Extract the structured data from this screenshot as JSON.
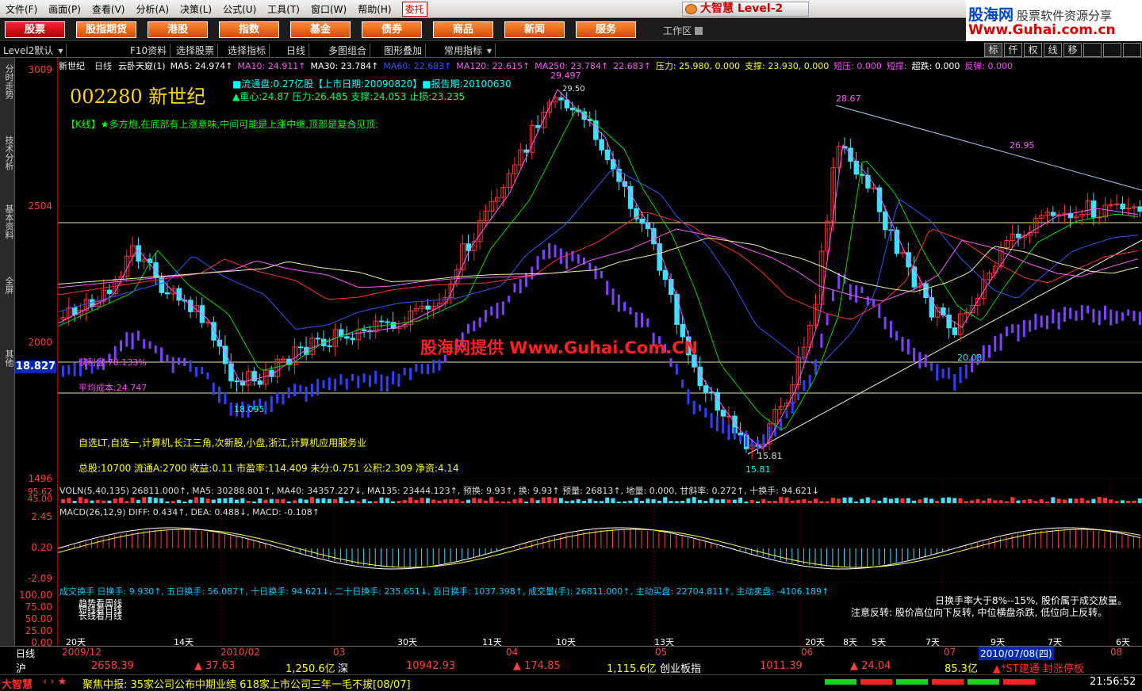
{
  "menu": {
    "items": [
      "文件(F)",
      "画面(P)",
      "查看(V)",
      "分析(A)",
      "决策(L)",
      "公式(U)",
      "工具(T)",
      "窗口(W)",
      "帮助(H)"
    ],
    "entrust": "委托",
    "brand": "大智慧 Level-2"
  },
  "guhai": {
    "title": "股海网",
    "slogan": "股票软件资源分享",
    "url": "Www.Guhai.com.cn"
  },
  "nav": {
    "items": [
      "股票",
      "股指期货",
      "港股",
      "指数",
      "基金",
      "债券",
      "商品",
      "新闻",
      "服务"
    ],
    "workspace": "工作区"
  },
  "toolbar": {
    "items": [
      "Level2默认",
      "F10资料",
      "选择股票",
      "选择指标",
      "日线",
      "多图组合",
      "图形叠加",
      "常用指标"
    ],
    "right": [
      "标",
      "仟",
      "权",
      "线",
      "移",
      "",
      "",
      ""
    ]
  },
  "lefttabs": [
    "分时走势",
    "技术分析",
    "基本资料",
    "全屏",
    "其他"
  ],
  "axis": {
    "price": [
      "3009",
      "2504",
      "2000",
      "1496"
    ],
    "last": "18.827",
    "vol": [
      "95.62",
      "45.00"
    ],
    "macd": [
      "2.45",
      "0.20",
      "-2.09"
    ],
    "turnover": [
      "100.00",
      "75.00",
      "50.00",
      "25.00",
      "0.00"
    ]
  },
  "header": {
    "name": "新世纪",
    "period": "日线",
    "indicator": "云卧天窥(1)",
    "ma": [
      {
        "t": "MA5: 24.974↑",
        "c": "#ffffff"
      },
      {
        "t": "MA10: 24.911↑",
        "c": "#ff55ff"
      },
      {
        "t": "MA30: 23.784↑",
        "c": "#ffffff"
      },
      {
        "t": "MA60: 22.683↑",
        "c": "#3355ff"
      },
      {
        "t": "MA120: 22.615↑",
        "c": "#ff55ff"
      },
      {
        "t": "MA250: 23.784↑",
        "c": "#ff55ff"
      },
      {
        "t": "22.683↑",
        "c": "#ff55ff"
      },
      {
        "t": "压力: 25.980, 0.000",
        "c": "#ffff00"
      },
      {
        "t": "支撑: 23.930, 0.000",
        "c": "#ffff00"
      },
      {
        "t": "短压: 0.000",
        "c": "#ff44ff"
      },
      {
        "t": "短撑:",
        "c": "#ff44ff"
      },
      {
        "t": "超跌: 0.000",
        "c": "#ffffff"
      },
      {
        "t": "反弹: 0.000",
        "c": "#ff44ff"
      }
    ]
  },
  "stock": {
    "code": "002280",
    "name": "新世纪",
    "float": "■流通盘:0.27亿股【上市日期:20090820】■报告期:20100630",
    "center": "▲重心:24.87 压力:26.485 支撑:24.053 止损:23.235",
    "comment": "【K线】★多方炮,在底部有上涨意味,中间可能是上涨中继,顶部是复合见顶:",
    "profit": "获利盘:78.133%",
    "avgcost": "平均成本:24.747",
    "blocks": "自选LT,自选一,计算机,长江三角,次新股,小盘,浙江,计算机应用服务业",
    "fund": "总股:10700 流通A:2700 收益:0.11 市盈率:114.409 未分:0.751 公积:2.309 净资:4.14"
  },
  "labels": {
    "hi1": "29.497",
    "hi1b": "29.50",
    "hi2": "28.67",
    "hi3": "26.95",
    "lo1": "18.095",
    "lo2": "15.81",
    "lo2b": "15.81",
    "lo3": "20.03"
  },
  "watermark": "股海网提供 Www.Guhai.Com.CN",
  "vol": {
    "line": "VOLN(5,40,135)  26811.000↑, MA5: 30288.801↑, MA40: 34357.227↓, MA135: 23444.123↑, 预换: 9.93↑, 换: 9.93↑ 预量: 26813↑, 地量: 0.000, 甘斜率: 0.272↑, 十换手: 94.621↓"
  },
  "macd": {
    "line": "MACD(26,12,9)  DIFF: 0.434↑, DEA: 0.488↓, MACD: -0.108↑"
  },
  "turn": {
    "line": "成交换手  日换手: 9.930↑, 五日换手: 56.087↑, 十日换手: 94.621↓, 二十日换手: 235.651↓, 百日换手: 1037.398↑, 成交量(手): 26811.000↑, 主动买盘: 22704.811↑, 主动卖盘: -4106.189↑",
    "n1": "日换手率大于8%--15%, 股价属于成交放量。",
    "n2": "注意反转: 股价高位向下反转, 中位横盘杀跌, 低位向上反转。",
    "side": [
      "趋势看周线",
      "短线看日线",
      "长线看月线"
    ],
    "days": [
      "20天",
      "14天",
      "30天",
      "11天",
      "10天",
      "13天",
      "20天",
      "8天",
      "5天",
      "7天",
      "9天",
      "7天",
      "6天"
    ],
    "months": [
      "2009/12",
      "2010/02",
      "03",
      "04",
      "05",
      "06",
      "07",
      "08"
    ],
    "cur": "2010/07/08(四)"
  },
  "status": {
    "period": "日线",
    "sh": "沪",
    "sh_idx": "2658.39",
    "sh_chg": "▲ 37.63",
    "sh_amt": "1,250.6亿",
    "sz": "深",
    "sz_idx": "10942.93",
    "sz_chg": "▲ 174.85",
    "sz_amt": "1,115.6亿",
    "cy": "创业板指",
    "cy_idx": "1011.39",
    "cy_chg": "▲ 24.04",
    "cy_amt": "85.3亿",
    "alert": "▲*ST建通  封涨停板"
  },
  "ticker": {
    "logo": "大智慧",
    "text": "聚焦中报: 35家公司公布中期业绩 618家上市公司三年一毛不拔[08/07]",
    "time": "21:56:52"
  }
}
